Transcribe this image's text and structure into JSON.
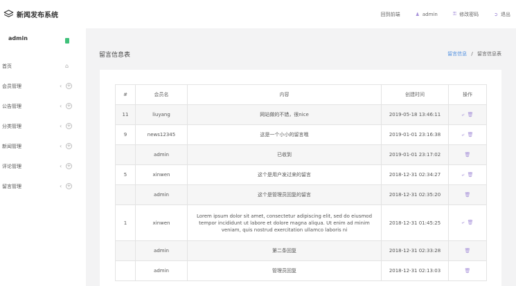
{
  "app": {
    "title": "新闻发布系统"
  },
  "header": {
    "links": [
      {
        "label": "回到前端",
        "icon": "none"
      },
      {
        "label": "admin",
        "icon": "user-icon"
      },
      {
        "label": "修改密码",
        "icon": "key-icon"
      },
      {
        "label": "退出",
        "icon": "logout-icon"
      }
    ]
  },
  "sidebar": {
    "user_name": "admin",
    "items": [
      {
        "label": "首页",
        "icon": "home-icon"
      },
      {
        "label": "会员管理",
        "icon": "plus-circle-icon"
      },
      {
        "label": "公告管理",
        "icon": "plus-circle-icon"
      },
      {
        "label": "分类管理",
        "icon": "plus-circle-icon"
      },
      {
        "label": "新闻管理",
        "icon": "plus-circle-icon"
      },
      {
        "label": "评论管理",
        "icon": "plus-circle-icon"
      },
      {
        "label": "留言管理",
        "icon": "plus-circle-icon"
      }
    ]
  },
  "page": {
    "title": "留言信息表",
    "breadcrumb": {
      "link": "留言信息",
      "sep": "/",
      "current": "留言信息表"
    }
  },
  "table": {
    "headers": [
      "#",
      "会员名",
      "内容",
      "创建时间",
      "操作"
    ],
    "rows": [
      {
        "id": "11",
        "user": "liuyang",
        "content": "网站做的不错，很nice",
        "created": "2019-05-18 13:46:11",
        "actions": [
          "reply",
          "delete"
        ]
      },
      {
        "id": "9",
        "user": "news12345",
        "content": "这是一个小小的留言哦",
        "created": "2019-01-01 23:16:38",
        "actions": [
          "reply",
          "delete"
        ]
      },
      {
        "id": "",
        "user": "admin",
        "content": "已收到",
        "created": "2019-01-01 23:17:02",
        "actions": [
          "delete"
        ]
      },
      {
        "id": "5",
        "user": "xinwen",
        "content": "这个是用户发过来的留言",
        "created": "2018-12-31 02:34:27",
        "actions": [
          "reply",
          "delete"
        ]
      },
      {
        "id": "",
        "user": "admin",
        "content": "这个是管理员回复的留言",
        "created": "2018-12-31 02:35:20",
        "actions": [
          "delete"
        ]
      },
      {
        "id": "1",
        "user": "xinwen",
        "content": "Lorem ipsum dolor sit amet, consectetur adipiscing elit, sed do eiusmod tempor incididunt ut labore et dolore magna aliqua. Ut enim ad minim veniam, quis nostrud exercitation ullamco laboris ni",
        "created": "2018-12-31 01:45:25",
        "actions": [
          "reply",
          "delete"
        ]
      },
      {
        "id": "",
        "user": "admin",
        "content": "第二条回复",
        "created": "2018-12-31 02:33:28",
        "actions": [
          "delete"
        ]
      },
      {
        "id": "",
        "user": "admin",
        "content": "管理员回复",
        "created": "2018-12-31 02:13:03",
        "actions": [
          "delete"
        ]
      }
    ]
  },
  "colors": {
    "accent": "#a58fd9",
    "link": "#4f8fe0",
    "badge": "#3fc17a",
    "main_bg": "#f3f3f4"
  }
}
